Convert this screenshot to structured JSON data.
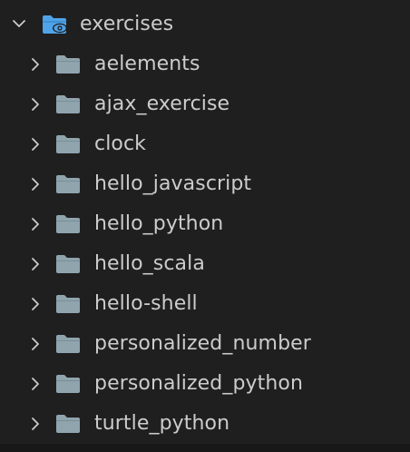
{
  "explorer": {
    "root": {
      "label": "exercises",
      "expanded": true,
      "icon": "folder-open-eye-icon",
      "icon_color": "#4fa3e8"
    },
    "folder_icon_color": "#90a4ae",
    "chevron_color": "#cccccc",
    "items": [
      {
        "label": "aelements",
        "icon": "folder-icon"
      },
      {
        "label": "ajax_exercise",
        "icon": "folder-icon"
      },
      {
        "label": "clock",
        "icon": "folder-icon"
      },
      {
        "label": "hello_javascript",
        "icon": "folder-icon"
      },
      {
        "label": "hello_python",
        "icon": "folder-icon"
      },
      {
        "label": "hello_scala",
        "icon": "folder-icon"
      },
      {
        "label": "hello-shell",
        "icon": "folder-icon"
      },
      {
        "label": "personalized_number",
        "icon": "folder-icon"
      },
      {
        "label": "personalized_python",
        "icon": "folder-icon"
      },
      {
        "label": "turtle_python",
        "icon": "folder-icon"
      }
    ]
  }
}
